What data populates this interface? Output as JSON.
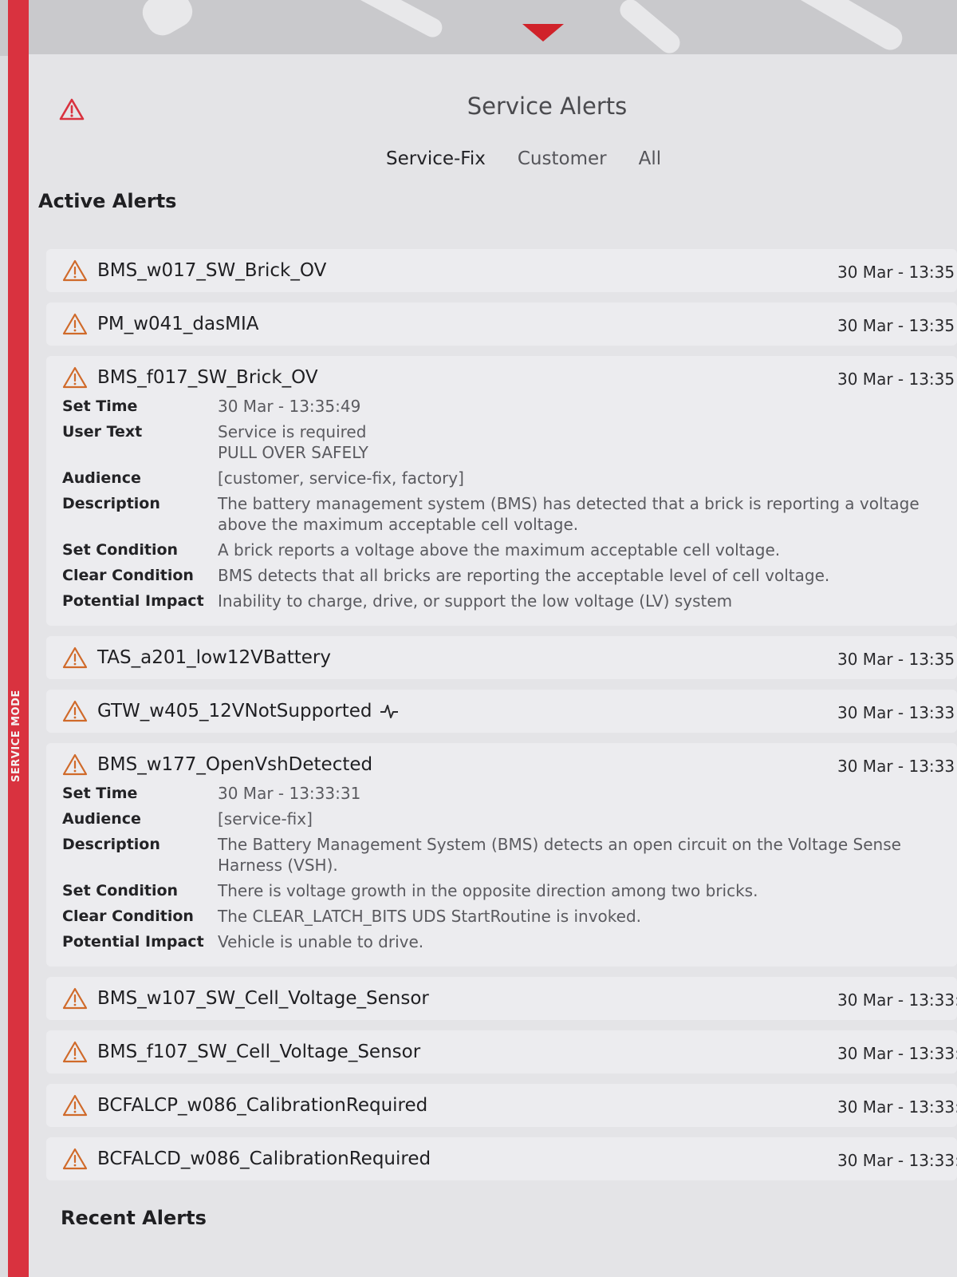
{
  "service_mode_label": "SERVICE MODE",
  "header": {
    "title": "Service Alerts",
    "tabs": [
      "Service-Fix",
      "Customer",
      "All"
    ]
  },
  "sections": {
    "active": "Active Alerts",
    "recent": "Recent Alerts"
  },
  "alerts": [
    {
      "name": "BMS_w017_SW_Brick_OV",
      "time": "30 Mar - 13:35"
    },
    {
      "name": "PM_w041_dasMIA",
      "time": "30 Mar - 13:35"
    },
    {
      "name": "BMS_f017_SW_Brick_OV",
      "time": "30 Mar - 13:35",
      "details": [
        {
          "label": "Set Time",
          "value": "30 Mar - 13:35:49"
        },
        {
          "label": "User Text",
          "value": "Service is required\nPULL OVER SAFELY"
        },
        {
          "label": "Audience",
          "value": "[customer, service-fix, factory]"
        },
        {
          "label": "Description",
          "value": "The battery management system (BMS) has detected that a brick is reporting a voltage above the maximum acceptable cell voltage."
        },
        {
          "label": "Set Condition",
          "value": "A brick reports a voltage above the maximum acceptable cell voltage."
        },
        {
          "label": "Clear Condition",
          "value": "BMS detects that all bricks are reporting the acceptable level of cell voltage."
        },
        {
          "label": "Potential Impact",
          "value": "Inability to charge, drive, or support the low voltage (LV) system"
        }
      ]
    },
    {
      "name": "TAS_a201_low12VBattery",
      "time": "30 Mar - 13:35"
    },
    {
      "name": "GTW_w405_12VNotSupported",
      "time": "30 Mar - 13:33",
      "pulse": true
    },
    {
      "name": "BMS_w177_OpenVshDetected",
      "time": "30 Mar - 13:33",
      "details": [
        {
          "label": "Set Time",
          "value": "30 Mar - 13:33:31"
        },
        {
          "label": "Audience",
          "value": "[service-fix]"
        },
        {
          "label": "Description",
          "value": "The Battery Management System (BMS) detects an open circuit on the Voltage Sense Harness (VSH)."
        },
        {
          "label": "Set Condition",
          "value": "There is voltage growth in the opposite direction among two bricks."
        },
        {
          "label": "Clear Condition",
          "value": "The CLEAR_LATCH_BITS UDS StartRoutine is invoked."
        },
        {
          "label": "Potential Impact",
          "value": "Vehicle is unable to drive."
        }
      ]
    },
    {
      "name": "BMS_w107_SW_Cell_Voltage_Sensor",
      "time": "30 Mar - 13:33:3"
    },
    {
      "name": "BMS_f107_SW_Cell_Voltage_Sensor",
      "time": "30 Mar - 13:33:3"
    },
    {
      "name": "BCFALCP_w086_CalibrationRequired",
      "time": "30 Mar - 13:33:3"
    },
    {
      "name": "BCFALCD_w086_CalibrationRequired",
      "time": "30 Mar - 13:33:3"
    }
  ],
  "colors": {
    "service_bar": "#d9323f",
    "warning": "#d9323f",
    "panel": "#e4e4e7"
  }
}
